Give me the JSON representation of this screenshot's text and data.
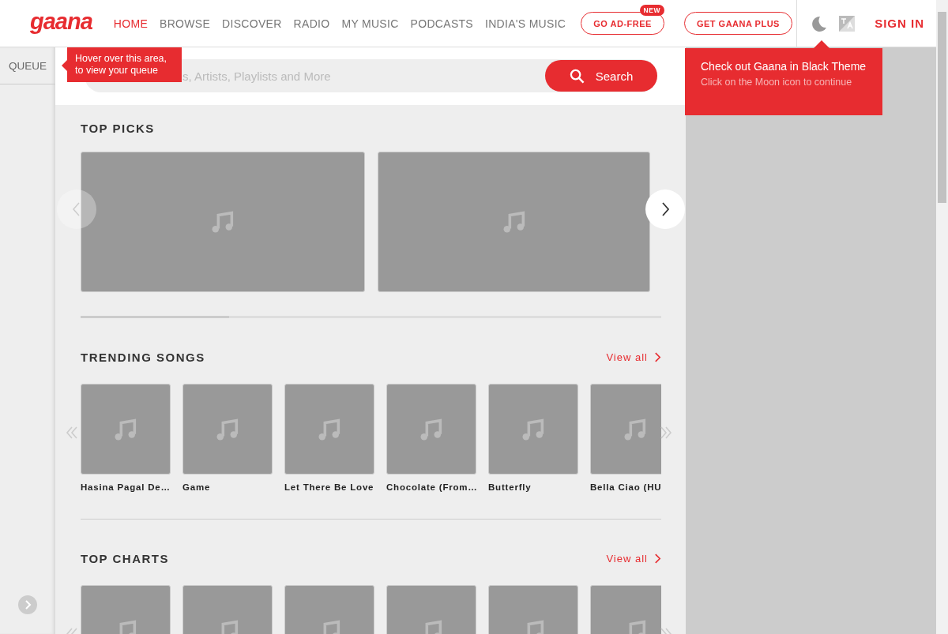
{
  "header": {
    "logo": "gaana",
    "nav": [
      {
        "label": "HOME",
        "selected": true
      },
      {
        "label": "BROWSE",
        "selected": false
      },
      {
        "label": "DISCOVER",
        "selected": false
      },
      {
        "label": "RADIO",
        "selected": false
      },
      {
        "label": "MY MUSIC",
        "selected": false
      },
      {
        "label": "PODCASTS",
        "selected": false
      },
      {
        "label": "INDIA'S MUSIC",
        "selected": false
      }
    ],
    "ad_free_button": {
      "label": "GO AD-FREE",
      "badge": "NEW"
    },
    "plus_button": "GET GAANA PLUS",
    "sign_in": "SIGN IN"
  },
  "queue": {
    "label": "QUEUE",
    "tooltip": "Hover over this area, to view your queue"
  },
  "search": {
    "placeholder": "s, Artists, Playlists and More",
    "button": "Search"
  },
  "theme_tip": {
    "title": "Check out Gaana in Black Theme",
    "text": "Click on the Moon icon to continue"
  },
  "top_picks": {
    "title": "TOP PICKS"
  },
  "trending": {
    "title": "TRENDING SONGS",
    "view_all": "View all",
    "songs": [
      "Hasina Pagal De…",
      "Game",
      "Let There Be Love",
      "Chocolate (From…",
      "Butterfly",
      "Bella Ciao (HU"
    ]
  },
  "top_charts": {
    "title": "TOP CHARTS",
    "view_all": "View all"
  }
}
